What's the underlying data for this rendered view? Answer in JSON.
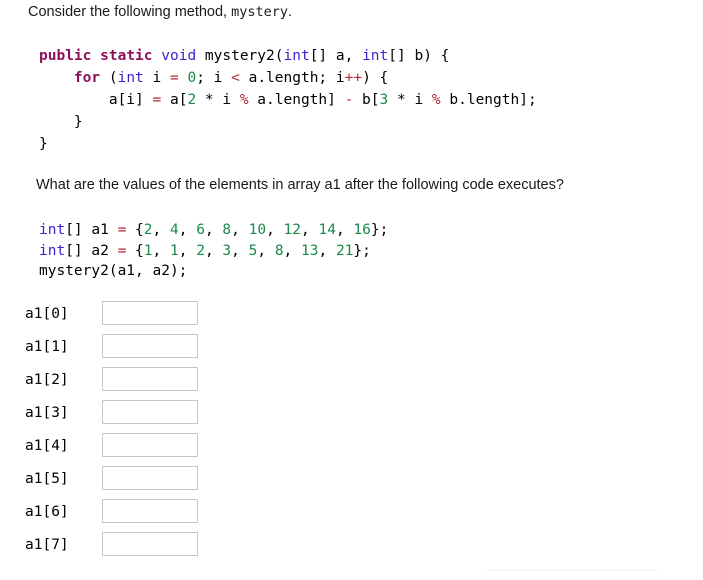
{
  "intro": {
    "text_before": "Consider the following method, ",
    "method_name": "mystery",
    "text_after": "."
  },
  "method_code": {
    "line1": {
      "kw_public": "public",
      "kw_static": "static",
      "typ_void": "void",
      "name": " mystery2(",
      "typ_int1": "int",
      "mid1": "[] a, ",
      "typ_int2": "int",
      "mid2": "[] b) {"
    },
    "line2": {
      "indent": "    ",
      "kw_for": "for",
      "open": " (",
      "typ_int": "int",
      "var": " i ",
      "op_eq": "=",
      "num_zero": " 0",
      "semi": "; i ",
      "op_lt": "<",
      "cond": " a.length; i",
      "op_inc": "++",
      "close": ") {"
    },
    "line3": {
      "indent": "        ",
      "lhs": "a[i] ",
      "op_eq": "=",
      "mid1": " a[",
      "num_two": "2",
      "mid2": " * i ",
      "op_mod1": "%",
      "mid3": " a.length] ",
      "op_minus": "-",
      "mid4": " b[",
      "num_three": "3",
      "mid5": " * i ",
      "op_mod2": "%",
      "mid6": " b.length];"
    },
    "line4": "    }",
    "line5": "}"
  },
  "question": "What are the values of the elements in array a1 after the following code executes?",
  "driver_code": {
    "decl_a1": {
      "typ_int": "int",
      "brackets": "[] a1 ",
      "op_eq": "=",
      "open": " {",
      "values": [
        "2",
        "4",
        "6",
        "8",
        "10",
        "12",
        "14",
        "16"
      ],
      "close": "};"
    },
    "decl_a2": {
      "typ_int": "int",
      "brackets": "[] a2 ",
      "op_eq": "=",
      "open": " {",
      "values": [
        "1",
        "1",
        "2",
        "3",
        "5",
        "8",
        "13",
        "21"
      ],
      "close": "};"
    },
    "call": "mystery2(a1, a2);"
  },
  "answers": {
    "rows": [
      {
        "label": "a1[0]",
        "value": "",
        "placeholder": ""
      },
      {
        "label": "a1[1]",
        "value": "",
        "placeholder": ""
      },
      {
        "label": "a1[2]",
        "value": "",
        "placeholder": ""
      },
      {
        "label": "a1[3]",
        "value": "",
        "placeholder": ""
      },
      {
        "label": "a1[4]",
        "value": "",
        "placeholder": ""
      },
      {
        "label": "a1[5]",
        "value": "",
        "placeholder": ""
      },
      {
        "label": "a1[6]",
        "value": "",
        "placeholder": ""
      },
      {
        "label": "a1[7]",
        "value": "",
        "placeholder": ""
      }
    ]
  },
  "colors": {
    "keyword": "#8f0f5a",
    "type": "#3b1fd1",
    "number": "#1a8a4a",
    "operator": "#b02a3a",
    "text": "#1a1a1a",
    "input_border": "#c6c6c6",
    "rule": "#f2f2f4"
  }
}
